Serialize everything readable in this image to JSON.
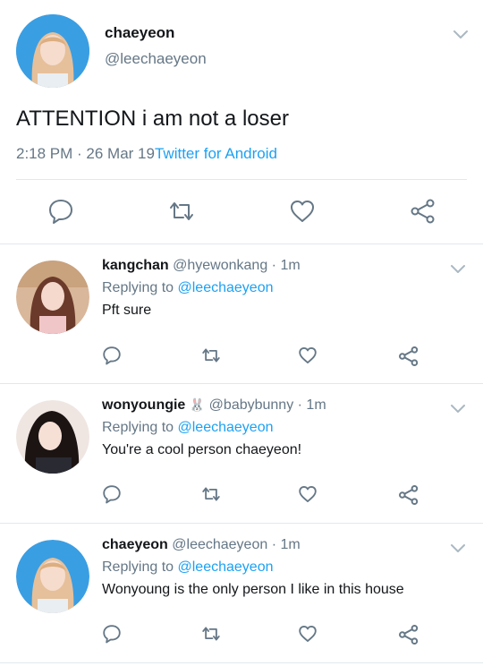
{
  "main_tweet": {
    "name": "chaeyeon",
    "handle": "@leechaeyeon",
    "text": "ATTENTION i am not a loser",
    "time": "2:18 PM · 26 Mar 19",
    "via": "Twitter for Android",
    "avatar": "avatar-chaeyeon"
  },
  "replies": [
    {
      "name": "kangchan",
      "handle": "@hyewonkang · 1m",
      "replying_prefix": "Replying to ",
      "replying_to": "@leechaeyeon",
      "text": "Pft sure",
      "avatar": "avatar-kangchan"
    },
    {
      "name": "wonyoungie",
      "emoji": "🐰",
      "handle": "@babybunny · 1m",
      "replying_prefix": "Replying to ",
      "replying_to": "@leechaeyeon",
      "text": "You're a cool person chaeyeon!",
      "avatar": "avatar-wonyoungie"
    },
    {
      "name": "chaeyeon",
      "handle": "@leechaeyeon · 1m",
      "replying_prefix": "Replying to ",
      "replying_to": "@leechaeyeon",
      "text": "Wonyoung is the only person I like in this house",
      "avatar": "avatar-chaeyeon"
    }
  ],
  "icons": [
    "reply-icon",
    "retweet-icon",
    "like-icon",
    "share-icon",
    "chevron-down-icon"
  ],
  "colors": {
    "link": "#1da1f2",
    "secondary": "#657786",
    "divider": "#e1e8ed"
  }
}
